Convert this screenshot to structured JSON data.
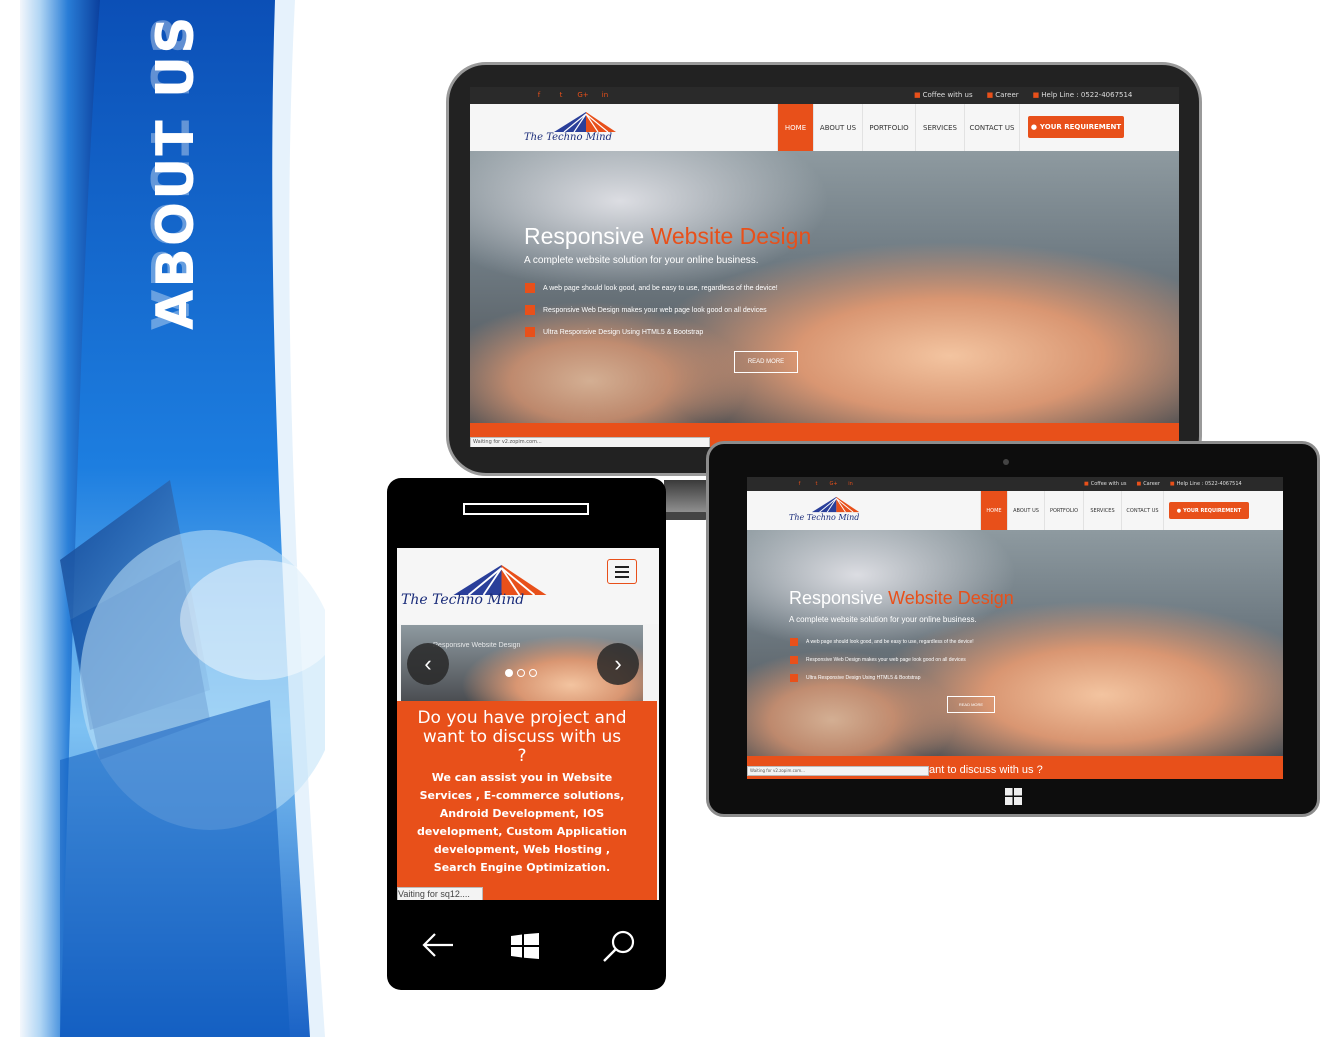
{
  "banner": {
    "title": "ABOUT US",
    "colors": {
      "blue": "#1a6fd0",
      "light": "#cfe6fb"
    }
  },
  "site": {
    "social": [
      "f",
      "t",
      "G+",
      "in"
    ],
    "topbar": {
      "coffee": "Coffee with us",
      "career": "Career",
      "helpline": "Help Line : 0522-4067514"
    },
    "logo": "The Techno Mind",
    "menu": [
      "HOME",
      "ABOUT US",
      "PORTFOLIO",
      "SERVICES",
      "CONTACT US"
    ],
    "requirement_button": "YOUR REQUIREMENT",
    "hero": {
      "title_a": "Responsive ",
      "title_b": "Website Design",
      "subtitle": "A complete website solution for your online business.",
      "bullets": [
        "A web page should look good, and be easy to use, regardless of the device!",
        "Responsive Web Design makes your web page look good on all devices",
        "Ultra Responsive Design Using HTML5 & Bootstrap"
      ],
      "read_more": "READ MORE"
    },
    "status": "Waiting for v2.zopim.com...",
    "tablet_strip": "ant to discuss with us ?",
    "accent": "#e8501a"
  },
  "phone": {
    "hero_title": "Responsive Website Design",
    "prev": "‹",
    "next": "›",
    "cta_title": "Do you have project and want to discuss with us ?",
    "cta_text": "We can assist you in Website Services , E-commerce solutions, Android Development, IOS development, Custom Application development, Web Hosting , Search Engine Optimization.",
    "status": "Vaiting for sq12....",
    "nav_icons": [
      "back-arrow-icon",
      "windows-icon",
      "search-icon"
    ]
  }
}
